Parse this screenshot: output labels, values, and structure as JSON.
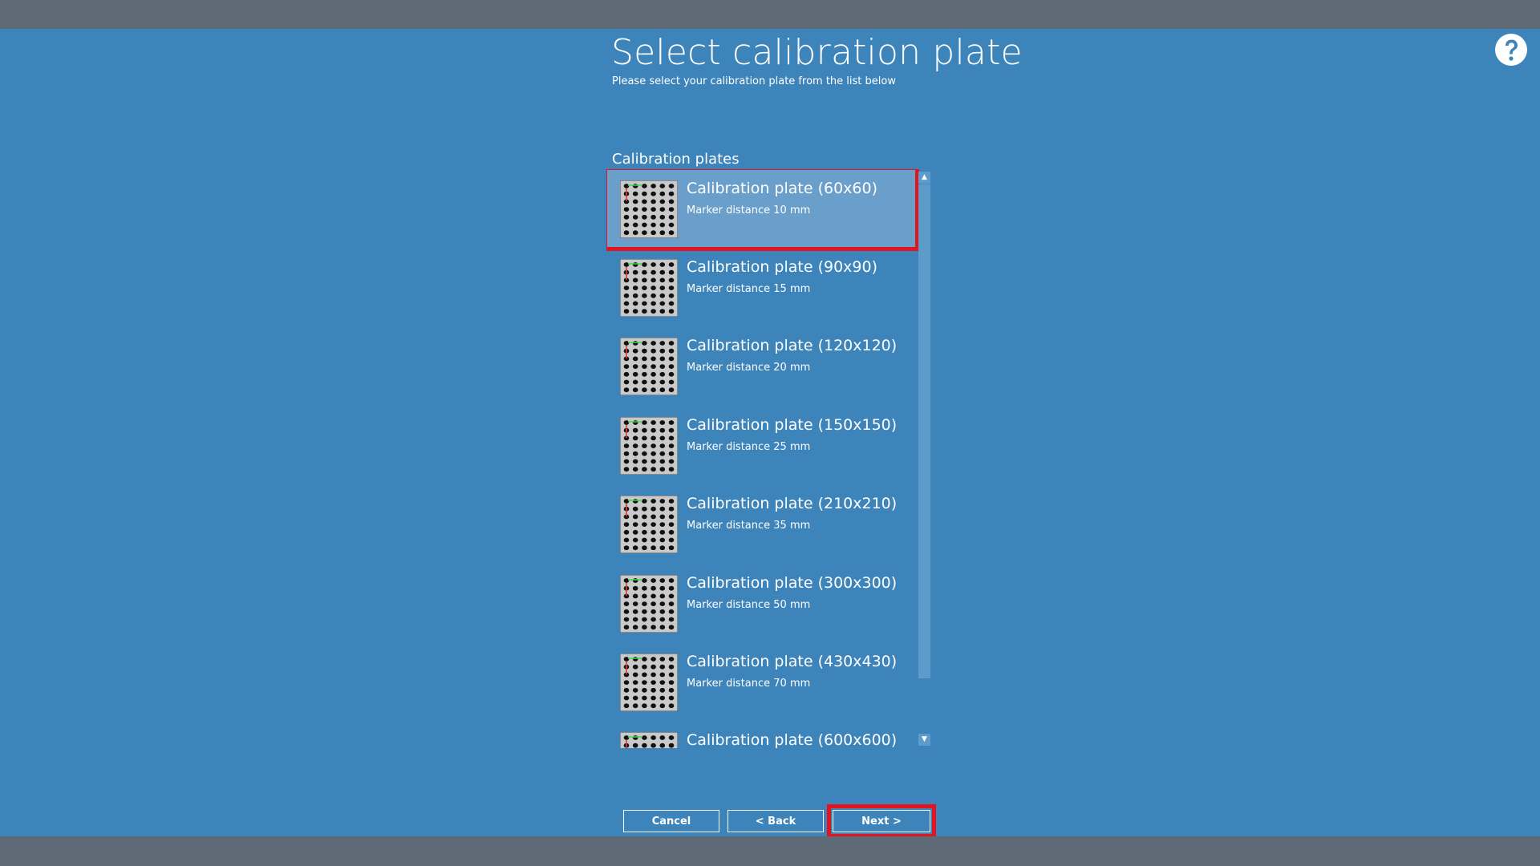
{
  "header": {
    "title": "Select calibration plate",
    "subtitle": "Please select your calibration plate from the list below",
    "help_icon": "question-circle-icon"
  },
  "list": {
    "label": "Calibration plates",
    "selected_index": 0,
    "items": [
      {
        "title": "Calibration plate (60x60)",
        "subtitle": "Marker distance 10 mm"
      },
      {
        "title": "Calibration plate (90x90)",
        "subtitle": "Marker distance 15 mm"
      },
      {
        "title": "Calibration plate (120x120)",
        "subtitle": "Marker distance 20 mm"
      },
      {
        "title": "Calibration plate (150x150)",
        "subtitle": "Marker distance 25 mm"
      },
      {
        "title": "Calibration plate (210x210)",
        "subtitle": "Marker distance 35 mm"
      },
      {
        "title": "Calibration plate (300x300)",
        "subtitle": "Marker distance 50 mm"
      },
      {
        "title": "Calibration plate (430x430)",
        "subtitle": "Marker distance 70 mm"
      },
      {
        "title": "Calibration plate (600x600)",
        "subtitle": ""
      }
    ]
  },
  "buttons": {
    "cancel": "Cancel",
    "back": "< Back",
    "next": "Next >"
  },
  "colors": {
    "background": "#3d84bb",
    "chrome_bar": "#5e6b77",
    "selection": "#6a9fcb",
    "highlight_frame": "#e1151e"
  }
}
